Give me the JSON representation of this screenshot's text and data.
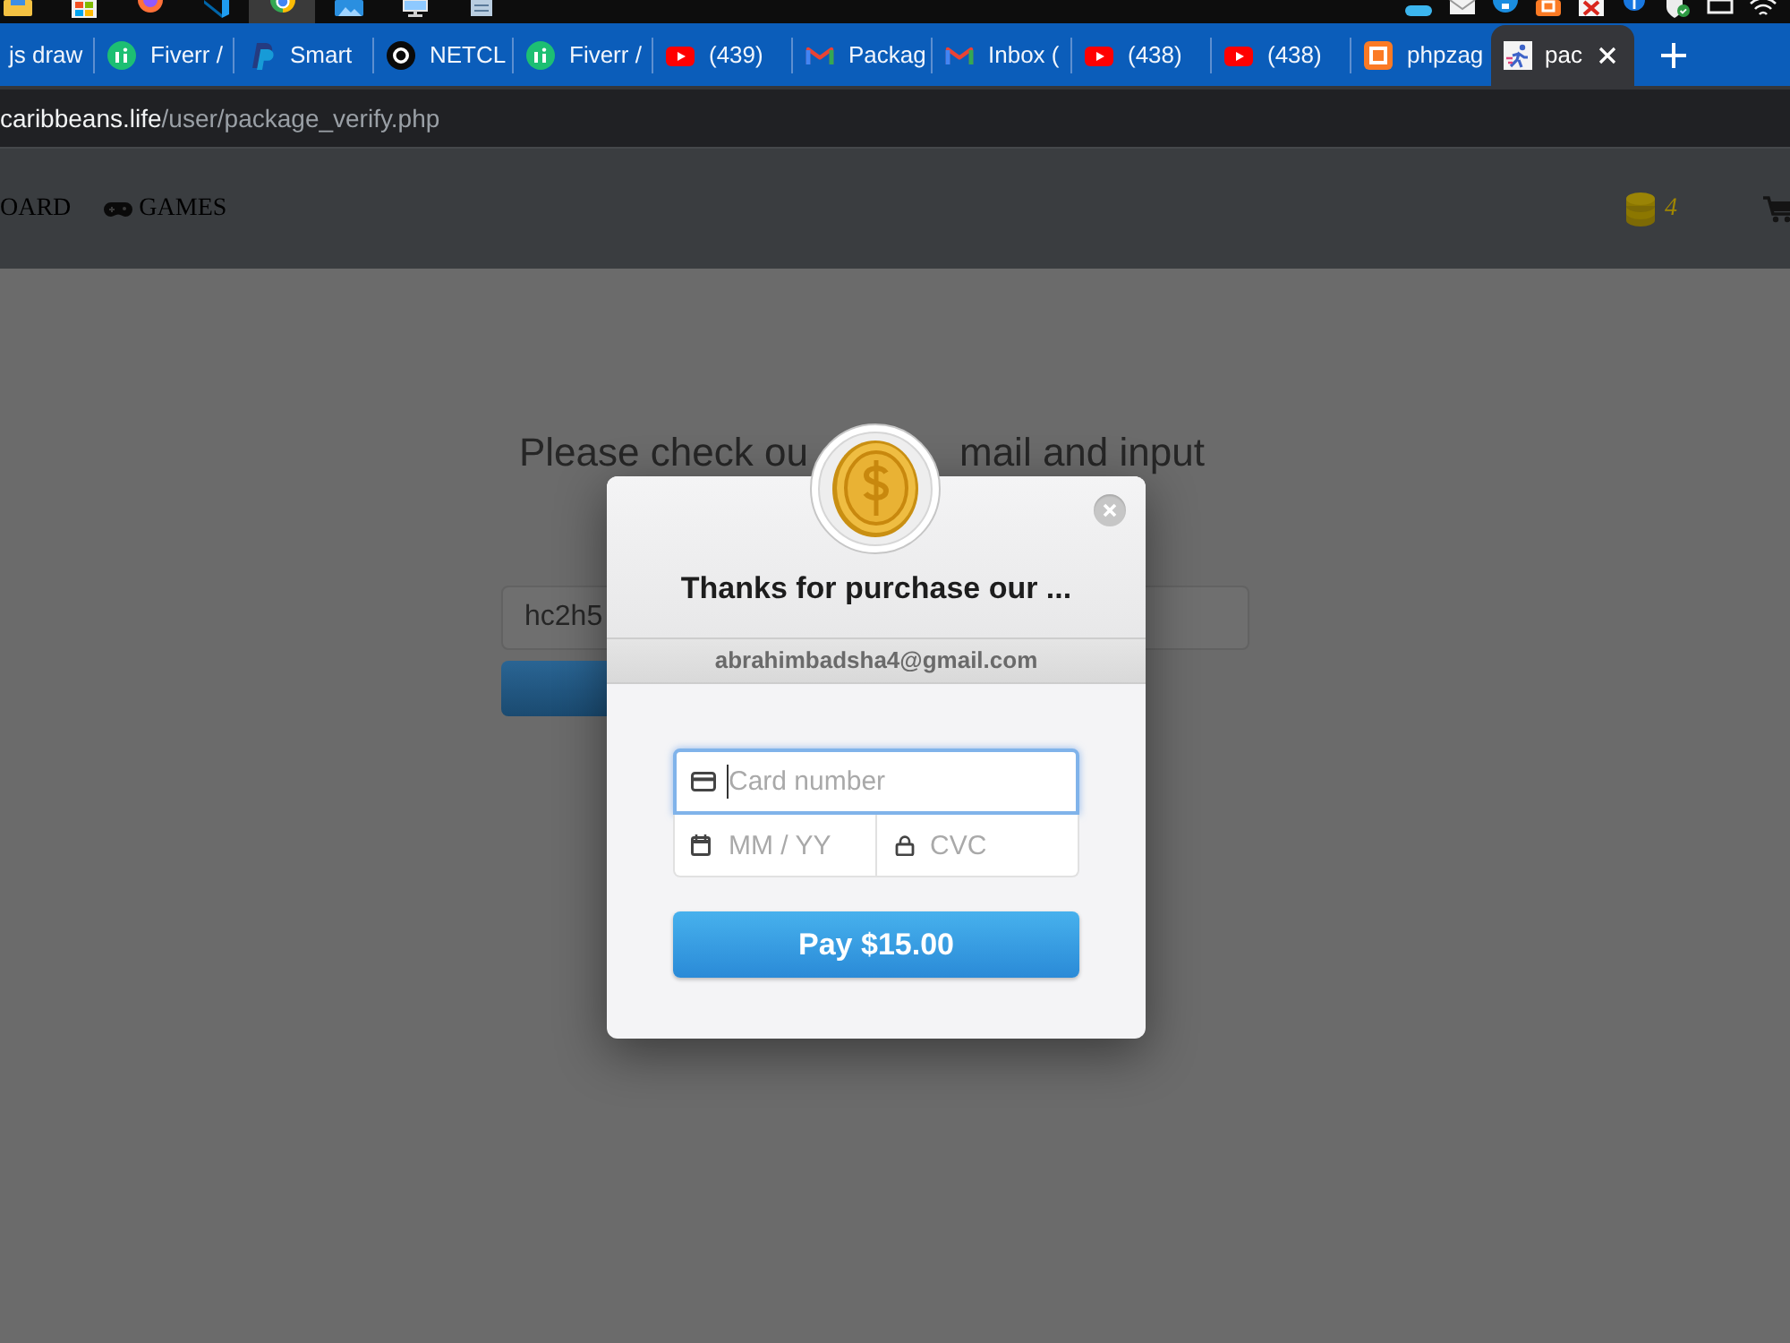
{
  "taskbar": {
    "apps": [
      {
        "kind": "folder",
        "selected": false
      },
      {
        "kind": "store",
        "selected": false
      },
      {
        "kind": "firefox",
        "selected": false
      },
      {
        "kind": "code",
        "selected": false
      },
      {
        "kind": "chrome",
        "selected": true
      },
      {
        "kind": "photos",
        "selected": false
      },
      {
        "kind": "monitor",
        "selected": false
      },
      {
        "kind": "notepad",
        "selected": false
      }
    ],
    "tray": [
      {
        "kind": "cloud"
      },
      {
        "kind": "mail"
      },
      {
        "kind": "skype"
      },
      {
        "kind": "xampp"
      },
      {
        "kind": "pdf"
      },
      {
        "kind": "bluetooth"
      },
      {
        "kind": "shield"
      },
      {
        "kind": "display"
      },
      {
        "kind": "wifi"
      }
    ]
  },
  "tabs": [
    {
      "title": "js draw",
      "kind": "plain",
      "selected": false
    },
    {
      "title": "Fiverr /",
      "kind": "fiverr",
      "selected": false
    },
    {
      "title": "Smart",
      "kind": "paypal",
      "selected": false
    },
    {
      "title": "NETCL",
      "kind": "netclan",
      "selected": false
    },
    {
      "title": "Fiverr /",
      "kind": "fiverr",
      "selected": false
    },
    {
      "title": "(439)",
      "kind": "youtube",
      "selected": false
    },
    {
      "title": "Packag",
      "kind": "gmail",
      "selected": false
    },
    {
      "title": "Inbox (",
      "kind": "gmail",
      "selected": false
    },
    {
      "title": "(438)",
      "kind": "youtube",
      "selected": false
    },
    {
      "title": "(438)",
      "kind": "youtube",
      "selected": false
    },
    {
      "title": "phpzag",
      "kind": "xampp",
      "selected": false
    },
    {
      "title": "pac",
      "kind": "runner",
      "selected": true
    }
  ],
  "address_bar": {
    "domain": "caribbeans.life",
    "path": "/user/package_verify.php"
  },
  "navbar": {
    "links": [
      {
        "label": "OARD",
        "kind": "plain"
      },
      {
        "label": "GAMES",
        "kind": "gamepad"
      }
    ],
    "coins": "4"
  },
  "page": {
    "heading": [
      "Please check ou",
      "mail and input"
    ],
    "code_value": "hc2h5"
  },
  "modal": {
    "title": "Thanks for purchase our ...",
    "email": "abrahimbadsha4@gmail.com",
    "card_number": {
      "placeholder": "Card number",
      "focused": true
    },
    "expiry": {
      "placeholder": "MM / YY"
    },
    "cvc": {
      "placeholder": "CVC"
    },
    "pay_button": "Pay $15.00"
  }
}
